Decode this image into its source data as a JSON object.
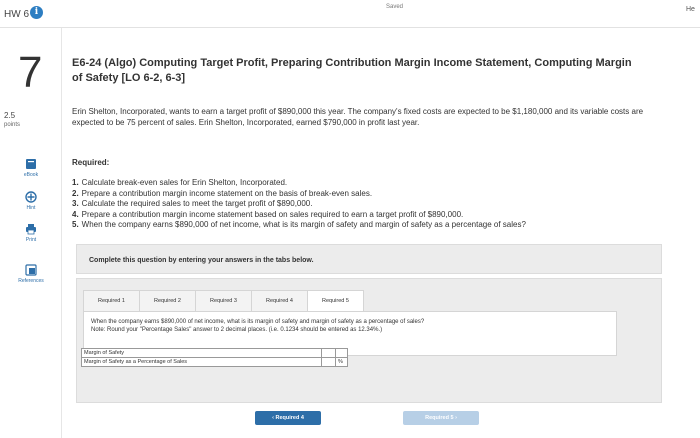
{
  "header": {
    "hw_title": "HW 6",
    "saved": "Saved",
    "right_edge_text": "He"
  },
  "question": {
    "number": "7",
    "points_value": "2.5",
    "points_label": "points",
    "title": "E6-24 (Algo) Computing Target Profit, Preparing Contribution Margin Income Statement, Computing Margin of Safety [LO 6-2, 6-3]",
    "body": "Erin Shelton, Incorporated, wants to earn a target profit of $890,000 this year. The company's fixed costs are expected to be $1,180,000 and its variable costs are expected to be 75 percent of sales. Erin Shelton, Incorporated, earned $790,000 in profit last year.",
    "required_heading": "Required:",
    "required_items": [
      {
        "num": "1.",
        "text": "Calculate break-even sales for Erin Shelton, Incorporated."
      },
      {
        "num": "2.",
        "text": "Prepare a contribution margin income statement on the basis of break-even sales."
      },
      {
        "num": "3.",
        "text": "Calculate the required sales to meet the target profit of $890,000."
      },
      {
        "num": "4.",
        "text": "Prepare a contribution margin income statement based on sales required to earn a target profit of $890,000."
      },
      {
        "num": "5.",
        "text": "When the company earns $890,000 of net income, what is its margin of safety and margin of safety as a percentage of sales?"
      }
    ]
  },
  "sidebar_tools": [
    {
      "label": "eBook",
      "icon": "book-icon"
    },
    {
      "label": "Hint",
      "icon": "hint-icon"
    },
    {
      "label": "Print",
      "icon": "print-icon"
    },
    {
      "label": "References",
      "icon": "references-icon"
    }
  ],
  "instructions": "Complete this question by entering your answers in the tabs below.",
  "tabs": [
    "Required 1",
    "Required 2",
    "Required 3",
    "Required 4",
    "Required 5"
  ],
  "active_tab": 4,
  "tab_content": {
    "prompt": "When the company earns $890,000 of net income, what is its margin of safety and margin of safety as a percentage of sales?",
    "note": "Note: Round your \"Percentage Sales\" answer to 2 decimal places. (i.e. 0.1234 should be entered as 12.34%.)",
    "rows": [
      {
        "label": "Margin of Safety",
        "value": "",
        "unit": ""
      },
      {
        "label": "Margin of Safety as a Percentage of Sales",
        "value": "",
        "unit": "%"
      }
    ]
  },
  "nav": {
    "prev_label": "Required 4",
    "next_label": "Required 5"
  },
  "colors": {
    "accent": "#2d6ea8",
    "disabled_button": "#b7cfe6",
    "panel_bg": "#ececec"
  }
}
